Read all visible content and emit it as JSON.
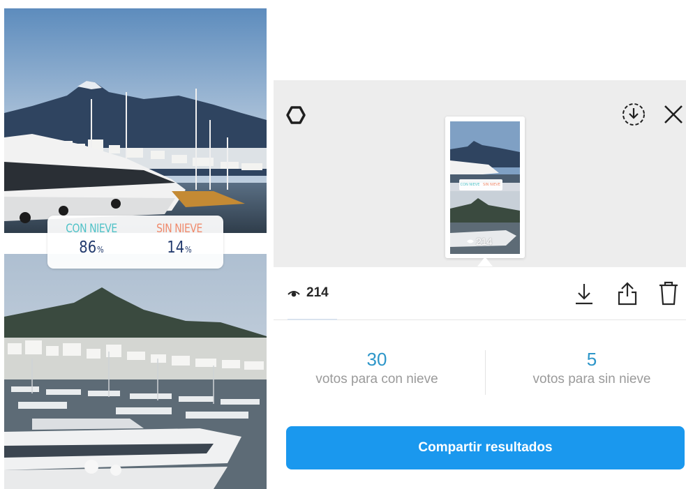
{
  "story": {
    "poll": {
      "option_a": {
        "label": "CON NIEVE",
        "percent": "86",
        "percent_sign": "%",
        "color": "#4fc2c7"
      },
      "option_b": {
        "label": "SIN NIEVE",
        "percent": "14",
        "percent_sign": "%",
        "color": "#f08a6b"
      }
    }
  },
  "panel": {
    "icons": {
      "settings": "gear-icon",
      "save": "save-circle-download-icon",
      "close": "close-icon",
      "viewers": "eye-icon",
      "download": "download-icon",
      "share": "share-icon",
      "delete": "trash-icon"
    },
    "thumbnail": {
      "poll_a": "CON NIEVE",
      "poll_b": "SIN NIEVE",
      "views": "214"
    },
    "viewers_count": "214",
    "results": [
      {
        "count": "30",
        "label": "votos para con nieve"
      },
      {
        "count": "5",
        "label": "votos para sin nieve"
      }
    ],
    "share_button_label": "Compartir resultados",
    "colors": {
      "accent": "#1a98ee",
      "result_count": "#2d96c9",
      "header_bg": "#ededed"
    }
  }
}
